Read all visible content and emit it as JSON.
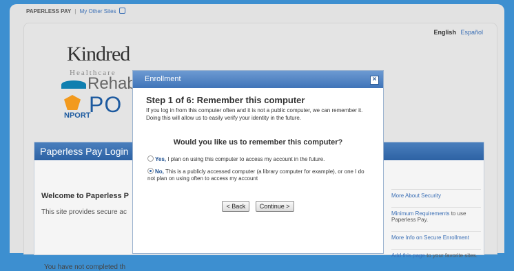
{
  "topbar": {
    "site": "PAPERLESS PAY",
    "separator": "|",
    "other_sites": "My Other Sites"
  },
  "lang": {
    "english": "English",
    "spanish": "Español"
  },
  "logos": {
    "kindred": "Kindred",
    "healthcare": "Healthcare",
    "rehab": "RehabCo",
    "nport": "NPORT",
    "po": "PO"
  },
  "panel": {
    "title": "Paperless Pay Login",
    "welcome": "Welcome to Paperless P",
    "provides": "This site provides secure ac",
    "not_completed": "You have not completed th"
  },
  "sidebar": {
    "security": "More About Security",
    "min_req_link": "Minimum Requirements",
    "min_req_rest": " to use Paperless Pay.",
    "secure_enroll": "More Info on Secure Enrollment",
    "add_page_link": "Add this page",
    "add_page_rest": " to your favorite sites."
  },
  "modal": {
    "title": "Enrollment",
    "close": "×",
    "step_title": "Step 1 of 6: Remember this computer",
    "step_desc": "If you log in from this computer often and it is not a public computer, we can remember it. Doing this will allow us to easily verify your identity in the future.",
    "question": "Would you like us to remember this computer?",
    "opt_yes_label": "Yes,",
    "opt_yes_text": " I plan on using this computer to access my account in the future.",
    "opt_no_label": "No,",
    "opt_no_text": " This is a publicly accessed computer (a library computer for example), or one I do not plan on using often to access my account",
    "back": "< Back",
    "continue": "Continue >"
  }
}
